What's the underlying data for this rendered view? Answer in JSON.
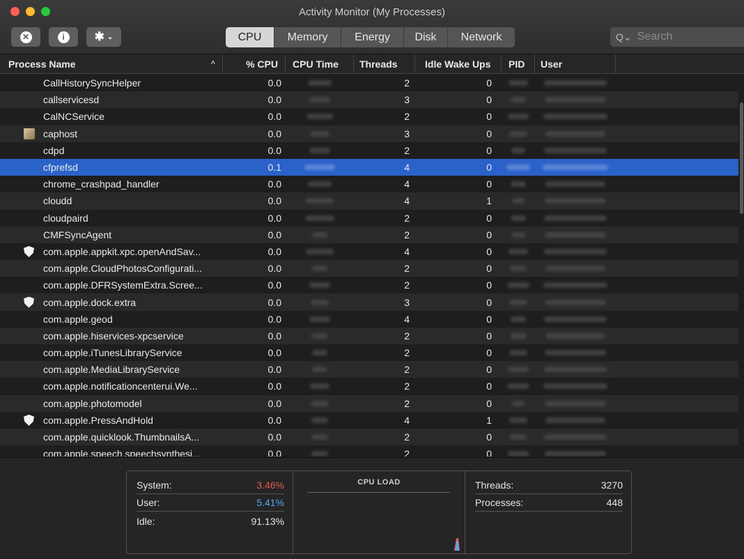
{
  "window": {
    "title": "Activity Monitor (My Processes)"
  },
  "toolbar": {
    "stop_icon": "stop-process-icon",
    "info_icon": "info-icon",
    "gear_icon": "gear-icon",
    "tabs": [
      "CPU",
      "Memory",
      "Energy",
      "Disk",
      "Network"
    ],
    "active_tab": "CPU",
    "search_placeholder": "Search"
  },
  "table": {
    "columns": [
      "Process Name",
      "% CPU",
      "CPU Time",
      "Threads",
      "Idle Wake Ups",
      "PID",
      "User"
    ],
    "sort_indicator": "^",
    "rows": [
      {
        "name": "CallHistorySyncHelper",
        "cpu": "0.0",
        "threads": "2",
        "idle": "0",
        "icon": ""
      },
      {
        "name": "callservicesd",
        "cpu": "0.0",
        "threads": "3",
        "idle": "0",
        "icon": ""
      },
      {
        "name": "CalNCService",
        "cpu": "0.0",
        "threads": "2",
        "idle": "0",
        "icon": ""
      },
      {
        "name": "caphost",
        "cpu": "0.0",
        "threads": "3",
        "idle": "0",
        "icon": "app-icon"
      },
      {
        "name": "cdpd",
        "cpu": "0.0",
        "threads": "2",
        "idle": "0",
        "icon": ""
      },
      {
        "name": "cfprefsd",
        "cpu": "0.1",
        "threads": "4",
        "idle": "0",
        "icon": "",
        "selected": true
      },
      {
        "name": "chrome_crashpad_handler",
        "cpu": "0.0",
        "threads": "4",
        "idle": "0",
        "icon": ""
      },
      {
        "name": "cloudd",
        "cpu": "0.0",
        "threads": "4",
        "idle": "1",
        "icon": ""
      },
      {
        "name": "cloudpaird",
        "cpu": "0.0",
        "threads": "2",
        "idle": "0",
        "icon": ""
      },
      {
        "name": "CMFSyncAgent",
        "cpu": "0.0",
        "threads": "2",
        "idle": "0",
        "icon": ""
      },
      {
        "name": "com.apple.appkit.xpc.openAndSav...",
        "cpu": "0.0",
        "threads": "4",
        "idle": "0",
        "icon": "shield-icon"
      },
      {
        "name": "com.apple.CloudPhotosConfigurati...",
        "cpu": "0.0",
        "threads": "2",
        "idle": "0",
        "icon": ""
      },
      {
        "name": "com.apple.DFRSystemExtra.Scree...",
        "cpu": "0.0",
        "threads": "2",
        "idle": "0",
        "icon": ""
      },
      {
        "name": "com.apple.dock.extra",
        "cpu": "0.0",
        "threads": "3",
        "idle": "0",
        "icon": "shield-icon"
      },
      {
        "name": "com.apple.geod",
        "cpu": "0.0",
        "threads": "4",
        "idle": "0",
        "icon": ""
      },
      {
        "name": "com.apple.hiservices-xpcservice",
        "cpu": "0.0",
        "threads": "2",
        "idle": "0",
        "icon": ""
      },
      {
        "name": "com.apple.iTunesLibraryService",
        "cpu": "0.0",
        "threads": "2",
        "idle": "0",
        "icon": ""
      },
      {
        "name": "com.apple.MediaLibraryService",
        "cpu": "0.0",
        "threads": "2",
        "idle": "0",
        "icon": ""
      },
      {
        "name": "com.apple.notificationcenterui.We...",
        "cpu": "0.0",
        "threads": "2",
        "idle": "0",
        "icon": ""
      },
      {
        "name": "com.apple.photomodel",
        "cpu": "0.0",
        "threads": "2",
        "idle": "0",
        "icon": ""
      },
      {
        "name": "com.apple.PressAndHold",
        "cpu": "0.0",
        "threads": "4",
        "idle": "1",
        "icon": "shield-icon"
      },
      {
        "name": "com.apple.quicklook.ThumbnailsA...",
        "cpu": "0.0",
        "threads": "2",
        "idle": "0",
        "icon": ""
      },
      {
        "name": "com.apple.speech.speechsynthesi...",
        "cpu": "0.0",
        "threads": "2",
        "idle": "0",
        "icon": ""
      }
    ]
  },
  "stats": {
    "system_label": "System:",
    "system_value": "3.46%",
    "user_label": "User:",
    "user_value": "5.41%",
    "idle_label": "Idle:",
    "idle_value": "91.13%",
    "load_title": "CPU LOAD",
    "threads_label": "Threads:",
    "threads_value": "3270",
    "processes_label": "Processes:",
    "processes_value": "448",
    "colors": {
      "system": "#e05a4e",
      "user": "#5aa6f0",
      "selection": "#2a62c9"
    }
  }
}
